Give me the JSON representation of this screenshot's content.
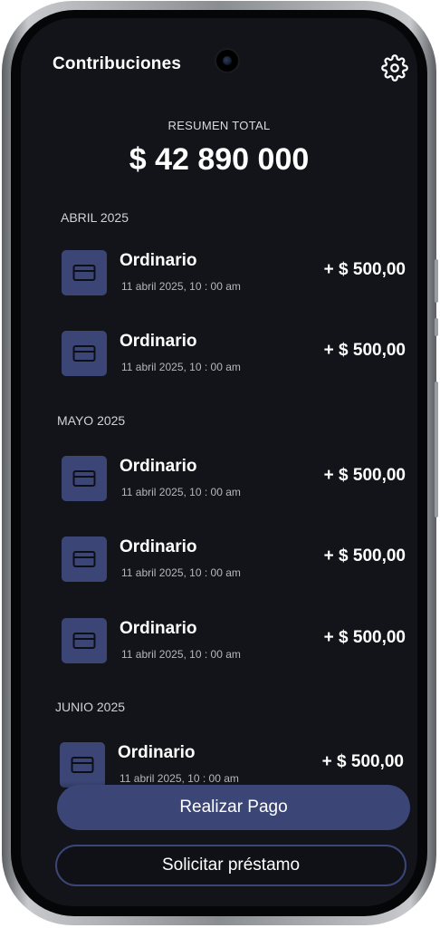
{
  "header": {
    "title": "Contribuciones",
    "settings_icon": "gear-icon"
  },
  "summary": {
    "label": "RESUMEN TOTAL",
    "value": "$ 42 890 000"
  },
  "sections": [
    {
      "label": "ABRIL 2025",
      "items": [
        {
          "icon": "card-icon",
          "title": "Ordinario",
          "date": "11 abril 2025, 10 : 00 am",
          "amount": "+ $ 500,00"
        },
        {
          "icon": "card-icon",
          "title": "Ordinario",
          "date": "11 abril 2025, 10 : 00 am",
          "amount": "+ $ 500,00"
        }
      ]
    },
    {
      "label": "MAYO 2025",
      "items": [
        {
          "icon": "card-icon",
          "title": "Ordinario",
          "date": "11 abril 2025, 10 : 00 am",
          "amount": "+ $ 500,00"
        },
        {
          "icon": "card-icon",
          "title": "Ordinario",
          "date": "11 abril 2025, 10 : 00 am",
          "amount": "+ $ 500,00"
        },
        {
          "icon": "card-icon",
          "title": "Ordinario",
          "date": "11 abril 2025, 10 : 00 am",
          "amount": "+ $ 500,00"
        }
      ]
    },
    {
      "label": "JUNIO 2025",
      "items": [
        {
          "icon": "card-icon",
          "title": "Ordinario",
          "date": "11 abril 2025, 10 : 00 am",
          "amount": "+ $ 500,00"
        }
      ]
    }
  ],
  "actions": {
    "primary_label": "Realizar Pago",
    "secondary_label": "Solicitar préstamo"
  },
  "colors": {
    "background": "#131419",
    "accent": "#3b4677",
    "text": "#ffffff"
  }
}
